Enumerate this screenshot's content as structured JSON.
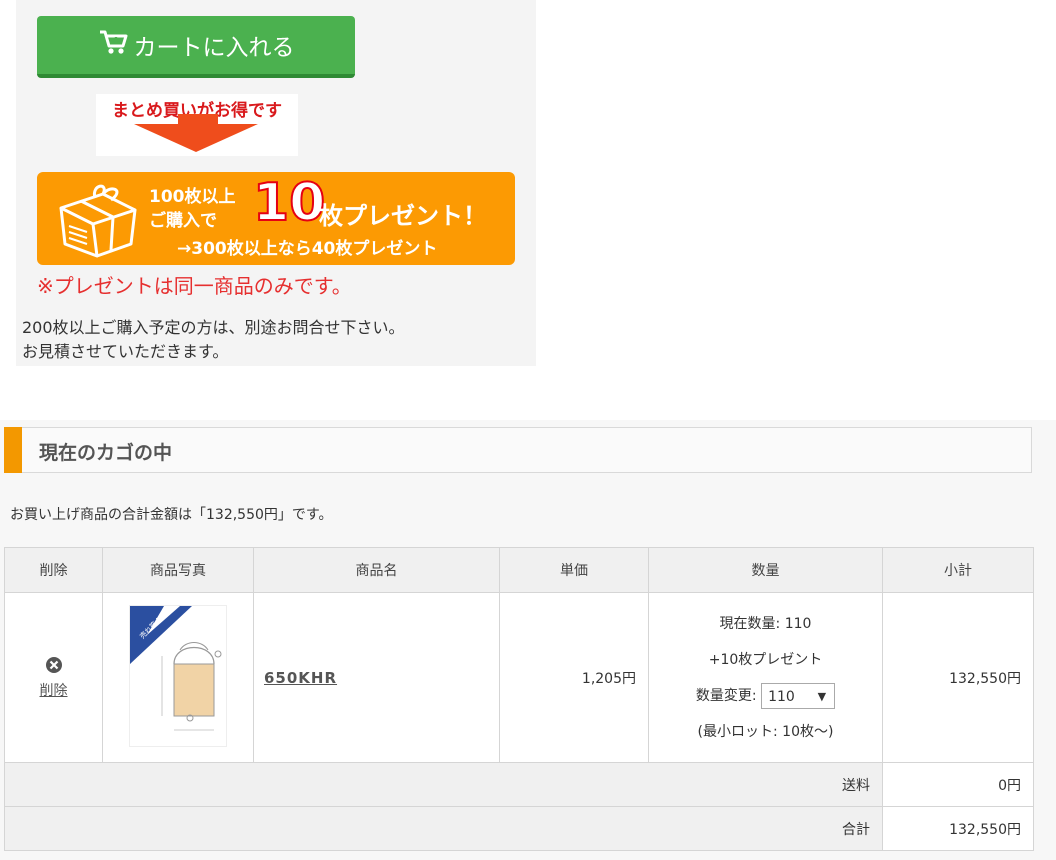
{
  "promo": {
    "cart_button_label": "カートに入れる",
    "bulk_text": "まとめ買いがお得です",
    "gift": {
      "line1": "100枚以上",
      "line2": "ご購入で",
      "big_number": "10",
      "suffix": "枚プレゼント！",
      "line3": "→300枚以上なら40枚プレゼント"
    },
    "present_note": "※プレゼントは同一商品のみです。",
    "inquiry_line1": "200枚以上ご購入予定の方は、別途お問合せ下さい。",
    "inquiry_line2": "お見積させていただきます。"
  },
  "cart": {
    "heading": "現在のカゴの中",
    "total_sentence": "お買い上げ商品の合計金額は「132,550円」です。",
    "columns": [
      "削除",
      "商品写真",
      "商品名",
      "単価",
      "数量",
      "小計"
    ],
    "item": {
      "delete_label": "削除",
      "photo_badge": "売れ筋 NO.1",
      "name": "650KHR",
      "unit_price": "1,205円",
      "current_qty": "現在数量: 110",
      "present": "+10枚プレゼント",
      "qty_change_label": "数量変更:",
      "qty_selected": "110",
      "min_lot": "(最小ロット: 10枚～)",
      "subtotal": "132,550円"
    },
    "shipping_label": "送料",
    "shipping_value": "0円",
    "total_label": "合計",
    "total_value": "132,550円"
  },
  "colors": {
    "cart_button": "#4bb14f",
    "gift_banner": "#fc9a03",
    "heading_accent": "#f39800",
    "note_red": "#e62f2f"
  },
  "icons": [
    "cart-add-icon",
    "down-arrow-icon",
    "gift-box-icon",
    "delete-x-icon",
    "chevron-down-icon"
  ]
}
